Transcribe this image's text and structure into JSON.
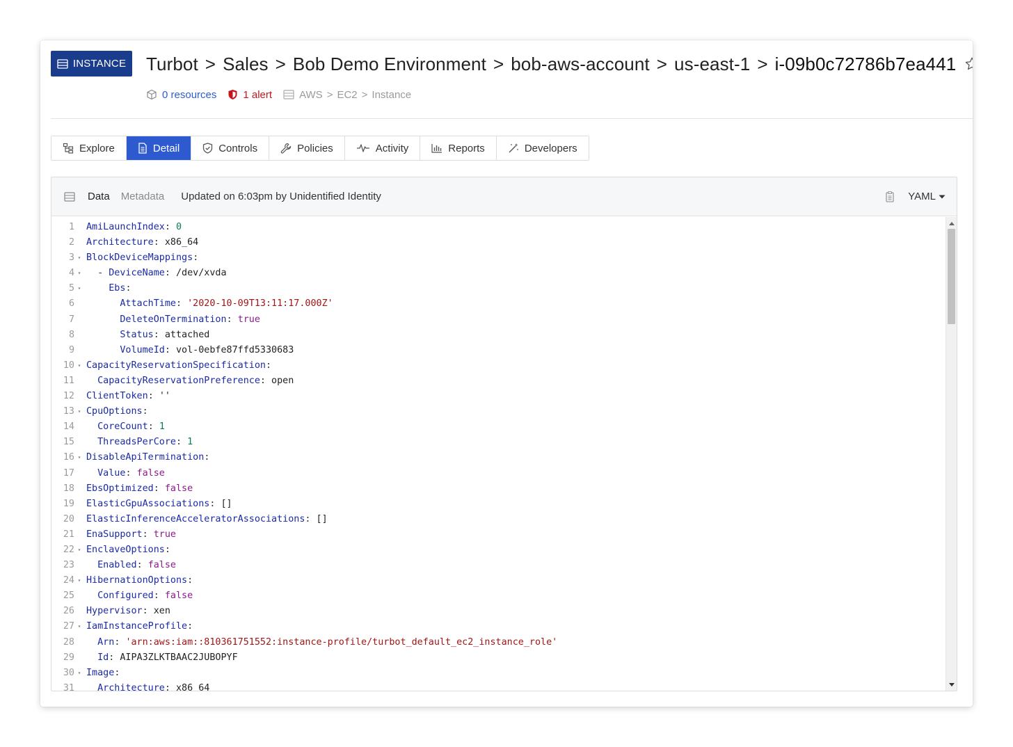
{
  "header": {
    "badge_label": "INSTANCE",
    "breadcrumb": [
      "Turbot",
      "Sales",
      "Bob Demo Environment",
      "bob-aws-account",
      "us-east-1"
    ],
    "breadcrumb_separator": ">",
    "current": "i-09b0c72786b7ea441",
    "resources": "0 resources",
    "alerts": "1 alert",
    "type_path": [
      "AWS",
      "EC2",
      "Instance"
    ],
    "type_separator": ">"
  },
  "tabs": [
    {
      "label": "Explore",
      "icon": "explore-icon",
      "active": false
    },
    {
      "label": "Detail",
      "icon": "document-icon",
      "active": true
    },
    {
      "label": "Controls",
      "icon": "shield-check-icon",
      "active": false
    },
    {
      "label": "Policies",
      "icon": "wrench-icon",
      "active": false
    },
    {
      "label": "Activity",
      "icon": "pulse-icon",
      "active": false
    },
    {
      "label": "Reports",
      "icon": "bar-chart-icon",
      "active": false
    },
    {
      "label": "Developers",
      "icon": "magic-wand-icon",
      "active": false
    }
  ],
  "panel": {
    "data_label": "Data",
    "metadata_label": "Metadata",
    "updated": "Updated on 6:03pm by Unidentified Identity",
    "format": "YAML"
  },
  "colors": {
    "accent": "#2e5ad0",
    "badge": "#1a3c8c",
    "alert": "#c5161d",
    "yaml_key": "#1a2aa6",
    "yaml_string": "#a31515",
    "yaml_bool": "#8b1a8b",
    "yaml_number": "#0b7a55"
  },
  "code_lines": [
    {
      "n": "1",
      "fold": false,
      "indent": 0,
      "key": "AmiLaunchIndex",
      "value": "0",
      "type": "num"
    },
    {
      "n": "2",
      "fold": false,
      "indent": 0,
      "key": "Architecture",
      "value": "x86_64",
      "type": "plain"
    },
    {
      "n": "3",
      "fold": true,
      "indent": 0,
      "key": "BlockDeviceMappings",
      "value": "",
      "type": "none"
    },
    {
      "n": "4",
      "fold": true,
      "indent": 2,
      "dash": true,
      "key": "DeviceName",
      "value": "/dev/xvda",
      "type": "plain"
    },
    {
      "n": "5",
      "fold": true,
      "indent": 4,
      "key": "Ebs",
      "value": "",
      "type": "none"
    },
    {
      "n": "6",
      "fold": false,
      "indent": 6,
      "key": "AttachTime",
      "value": "'2020-10-09T13:11:17.000Z'",
      "type": "str"
    },
    {
      "n": "7",
      "fold": false,
      "indent": 6,
      "key": "DeleteOnTermination",
      "value": "true",
      "type": "bool"
    },
    {
      "n": "8",
      "fold": false,
      "indent": 6,
      "key": "Status",
      "value": "attached",
      "type": "plain"
    },
    {
      "n": "9",
      "fold": false,
      "indent": 6,
      "key": "VolumeId",
      "value": "vol-0ebfe87ffd5330683",
      "type": "plain"
    },
    {
      "n": "10",
      "fold": true,
      "indent": 0,
      "key": "CapacityReservationSpecification",
      "value": "",
      "type": "none"
    },
    {
      "n": "11",
      "fold": false,
      "indent": 2,
      "key": "CapacityReservationPreference",
      "value": "open",
      "type": "plain"
    },
    {
      "n": "12",
      "fold": false,
      "indent": 0,
      "key": "ClientToken",
      "value": "''",
      "type": "plain"
    },
    {
      "n": "13",
      "fold": true,
      "indent": 0,
      "key": "CpuOptions",
      "value": "",
      "type": "none"
    },
    {
      "n": "14",
      "fold": false,
      "indent": 2,
      "key": "CoreCount",
      "value": "1",
      "type": "num"
    },
    {
      "n": "15",
      "fold": false,
      "indent": 2,
      "key": "ThreadsPerCore",
      "value": "1",
      "type": "num"
    },
    {
      "n": "16",
      "fold": true,
      "indent": 0,
      "key": "DisableApiTermination",
      "value": "",
      "type": "none"
    },
    {
      "n": "17",
      "fold": false,
      "indent": 2,
      "key": "Value",
      "value": "false",
      "type": "bool"
    },
    {
      "n": "18",
      "fold": false,
      "indent": 0,
      "key": "EbsOptimized",
      "value": "false",
      "type": "bool"
    },
    {
      "n": "19",
      "fold": false,
      "indent": 0,
      "key": "ElasticGpuAssociations",
      "value": "[]",
      "type": "plain"
    },
    {
      "n": "20",
      "fold": false,
      "indent": 0,
      "key": "ElasticInferenceAcceleratorAssociations",
      "value": "[]",
      "type": "plain"
    },
    {
      "n": "21",
      "fold": false,
      "indent": 0,
      "key": "EnaSupport",
      "value": "true",
      "type": "bool"
    },
    {
      "n": "22",
      "fold": true,
      "indent": 0,
      "key": "EnclaveOptions",
      "value": "",
      "type": "none"
    },
    {
      "n": "23",
      "fold": false,
      "indent": 2,
      "key": "Enabled",
      "value": "false",
      "type": "bool"
    },
    {
      "n": "24",
      "fold": true,
      "indent": 0,
      "key": "HibernationOptions",
      "value": "",
      "type": "none"
    },
    {
      "n": "25",
      "fold": false,
      "indent": 2,
      "key": "Configured",
      "value": "false",
      "type": "bool"
    },
    {
      "n": "26",
      "fold": false,
      "indent": 0,
      "key": "Hypervisor",
      "value": "xen",
      "type": "plain"
    },
    {
      "n": "27",
      "fold": true,
      "indent": 0,
      "key": "IamInstanceProfile",
      "value": "",
      "type": "none"
    },
    {
      "n": "28",
      "fold": false,
      "indent": 2,
      "key": "Arn",
      "value": "'arn:aws:iam::810361751552:instance-profile/turbot_default_ec2_instance_role'",
      "type": "str"
    },
    {
      "n": "29",
      "fold": false,
      "indent": 2,
      "key": "Id",
      "value": "AIPA3ZLKTBAAC2JUBOPYF",
      "type": "plain"
    },
    {
      "n": "30",
      "fold": true,
      "indent": 0,
      "key": "Image",
      "value": "",
      "type": "none"
    },
    {
      "n": "31",
      "fold": false,
      "indent": 2,
      "key": "Architecture",
      "value": "x86_64",
      "type": "plain"
    }
  ]
}
